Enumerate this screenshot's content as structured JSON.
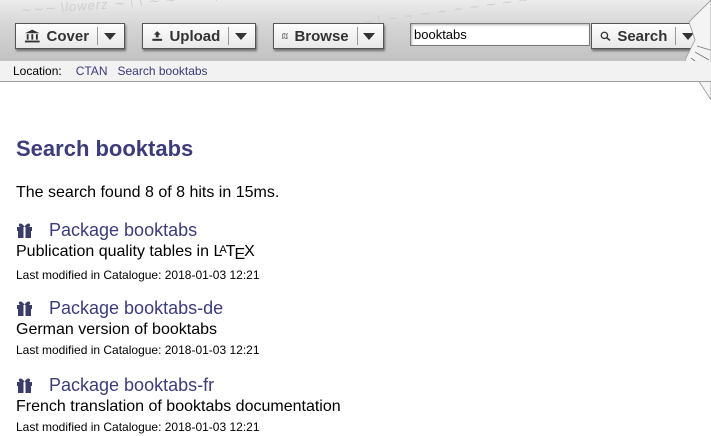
{
  "toolbar": {
    "cover_label": "Cover",
    "upload_label": "Upload",
    "browse_label": "Browse",
    "search_value": "booktabs",
    "search_label": "Search"
  },
  "location": {
    "label": "Location:",
    "crumbs": [
      "CTAN",
      "Search booktabs"
    ]
  },
  "page": {
    "title": "Search booktabs",
    "summary": "The search found 8 of 8 hits in 15ms."
  },
  "results": [
    {
      "title": "Package booktabs",
      "description_prefix": "Publication quality tables in ",
      "description_latex": true,
      "modified": "Last modified in Catalogue: 2018-01-03 12:21"
    },
    {
      "title": "Package booktabs-de",
      "description": "German version of booktabs",
      "modified": "Last modified in Catalogue: 2018-01-03 12:21"
    },
    {
      "title": "Package booktabs-fr",
      "description": "French translation of booktabs documentation",
      "modified": "Last modified in Catalogue: 2018-01-03 12:21"
    }
  ],
  "icons": {
    "cover": "bank-icon",
    "upload": "upload-icon",
    "browse": "map-icon",
    "search": "search-icon",
    "result": "gift-icon"
  },
  "colors": {
    "link": "#3c3c7a",
    "toolbar_bg": "#d4d4d4"
  }
}
